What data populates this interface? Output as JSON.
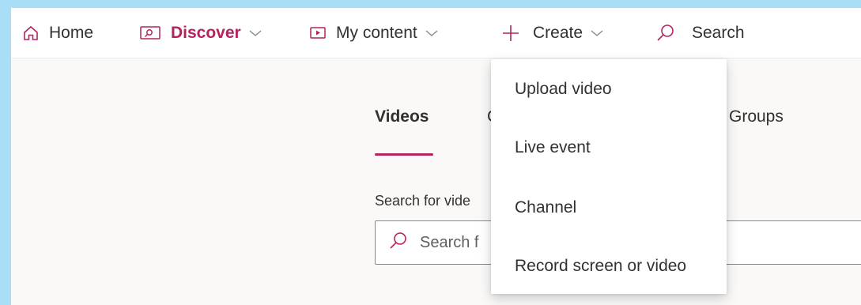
{
  "nav": {
    "home": "Home",
    "discover": "Discover",
    "my_content": "My content",
    "create": "Create",
    "search": "Search"
  },
  "tabs": {
    "videos": "Videos",
    "channels_partial": "C",
    "groups": "Groups"
  },
  "search": {
    "label_partial": "Search for vide",
    "placeholder_partial": "Search f"
  },
  "create_menu": {
    "items": [
      "Upload video",
      "Live event",
      "Channel",
      "Record screen or video"
    ]
  },
  "colors": {
    "accent": "#b4235f",
    "text": "#323130",
    "background": "#faf9f8",
    "outer_background": "#a8dff6"
  }
}
